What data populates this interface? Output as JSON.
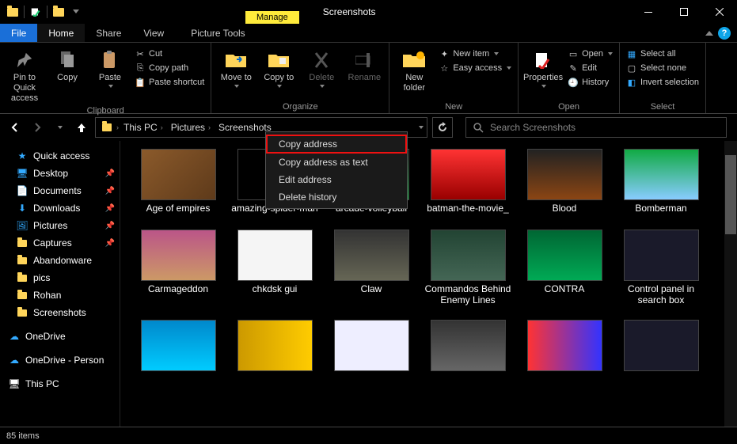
{
  "window": {
    "title": "Screenshots",
    "context_tab": "Manage",
    "context_tool": "Picture Tools"
  },
  "menu": {
    "file": "File",
    "tabs": [
      "Home",
      "Share",
      "View"
    ]
  },
  "ribbon": {
    "clipboard": {
      "label": "Clipboard",
      "pin": "Pin to Quick access",
      "copy": "Copy",
      "paste": "Paste",
      "cut": "Cut",
      "copy_path": "Copy path",
      "paste_shortcut": "Paste shortcut"
    },
    "organize": {
      "label": "Organize",
      "move_to": "Move to",
      "copy_to": "Copy to",
      "delete": "Delete",
      "rename": "Rename"
    },
    "new": {
      "label": "New",
      "new_folder": "New folder",
      "new_item": "New item",
      "easy_access": "Easy access"
    },
    "open": {
      "label": "Open",
      "properties": "Properties",
      "open": "Open",
      "edit": "Edit",
      "history": "History"
    },
    "select": {
      "label": "Select",
      "select_all": "Select all",
      "select_none": "Select none",
      "invert": "Invert selection"
    }
  },
  "breadcrumb": [
    "This PC",
    "Pictures",
    "Screenshots"
  ],
  "search": {
    "placeholder": "Search Screenshots"
  },
  "context_menu": [
    "Copy address",
    "Copy address as text",
    "Edit address",
    "Delete history"
  ],
  "sidebar": {
    "quick_access": "Quick access",
    "pinned": [
      "Desktop",
      "Documents",
      "Downloads",
      "Pictures",
      "Captures",
      "Abandonware",
      "pics",
      "Rohan",
      "Screenshots"
    ],
    "onedrive": "OneDrive",
    "onedrive_personal": "OneDrive - Person",
    "this_pc": "This PC"
  },
  "items_row1": [
    "Age of empires",
    "amazing-spider-man",
    "arcade-volleyball",
    "batman-the-movie_",
    "Blood",
    "Bomberman"
  ],
  "items_row2": [
    "Carmageddon",
    "chkdsk gui",
    "Claw",
    "Commandos Behind Enemy Lines",
    "CONTRA",
    "Control panel in search box"
  ],
  "thumbs_row1": [
    "linear-gradient(135deg,#8b5a2b,#5e3a1a)",
    "#000",
    "linear-gradient(#000,#0a3)",
    "linear-gradient(#f33,#900)",
    "linear-gradient(#222,#8b4513)",
    "linear-gradient(#1a4,#8cf)"
  ],
  "thumbs_row2": [
    "linear-gradient(#b58,#c96)",
    "#f5f5f5",
    "linear-gradient(#333,#665)",
    "linear-gradient(#243,#465)",
    "linear-gradient(#063,#0a5)",
    "#1a1a2a"
  ],
  "thumbs_row3": [
    "linear-gradient(#08c,#0cf)",
    "linear-gradient(90deg,#c90,#fc0)",
    "#eef",
    "linear-gradient(#333,#666)",
    "linear-gradient(90deg,#f33,#33f)",
    "#1a1a2a"
  ],
  "status": {
    "count": "85 items"
  }
}
